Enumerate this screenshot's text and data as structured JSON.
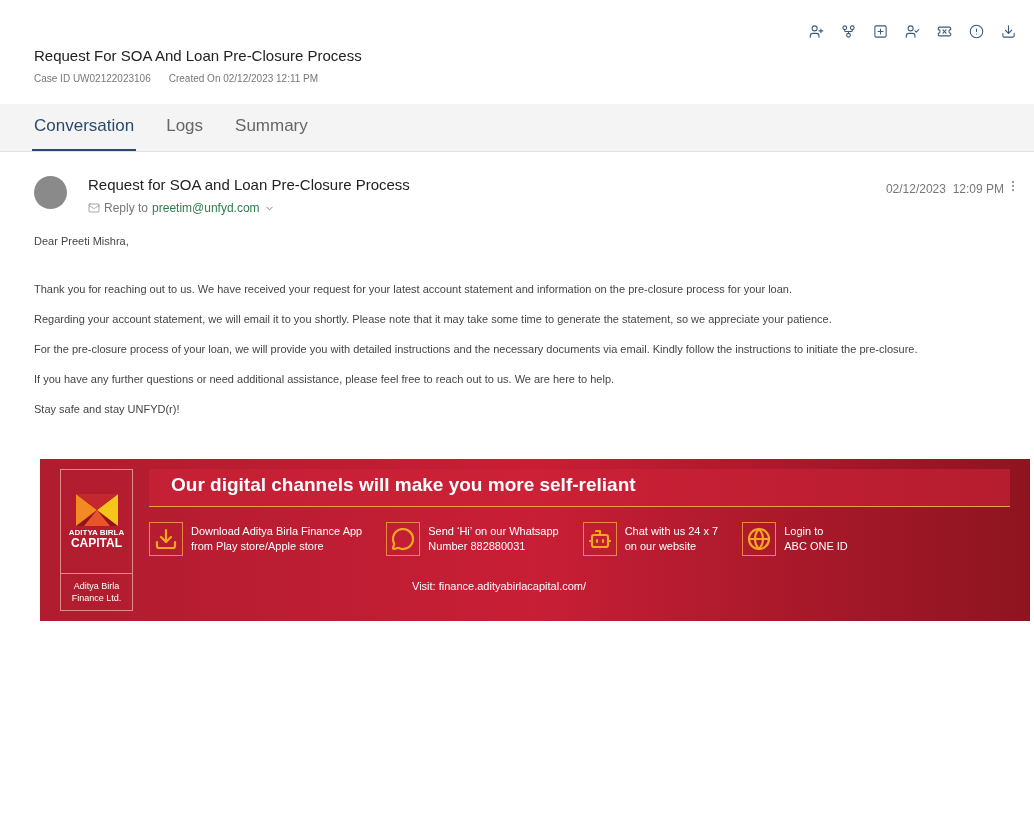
{
  "case": {
    "title": "Request For SOA And Loan Pre-Closure Process",
    "case_id": "Case ID UW02122023106",
    "created": "Created On 02/12/2023 12:11 PM"
  },
  "tabs": [
    {
      "label": "Conversation",
      "selected": true
    },
    {
      "label": "Logs",
      "selected": false
    },
    {
      "label": "Summary",
      "selected": false
    }
  ],
  "email": {
    "subject": "Request for SOA and Loan Pre-Closure Process",
    "reply_label": "Reply to",
    "reply_to": "preetim@unfyd.com",
    "timestamp": "02/12/2023  12:09 PM",
    "greeting": "Dear Preeti Mishra,",
    "paragraphs": [
      "Thank you for reaching out to us. We have received your request for your latest account statement and information on the pre-closure process for your loan.",
      "Regarding your account statement, we will email it to you shortly. Please note that it may take some time to generate the statement, so we appreciate your patience.",
      "For the pre-closure process of your loan, we will provide you with detailed instructions and the necessary documents via email. Kindly follow the instructions to initiate the pre-closure.",
      "If you have any further questions or need additional assistance, please feel free to reach out to us. We are here to help.",
      "Stay safe and stay UNFYD(r)!"
    ]
  },
  "banner": {
    "logo_top": "ADITYA BIRLA",
    "logo_main": "CAPITAL",
    "logo_sub": "Aditya Birla Finance Ltd.",
    "headline": "Our digital channels will make you more self-reliant",
    "items": [
      {
        "kind": "download",
        "lines": [
          "Download Aditya Birla Finance App",
          "from Play store/Apple store"
        ]
      },
      {
        "kind": "whatsapp",
        "lines": [
          "Send ‘Hi’ on our Whatsapp",
          "Number 882880031"
        ]
      },
      {
        "kind": "chat",
        "lines": [
          "Chat with us 24 x 7",
          "on our website"
        ]
      },
      {
        "kind": "login",
        "lines": [
          "Login to",
          "ABC ONE ID"
        ]
      }
    ],
    "visit": "Visit: finance.adityabirlacapital.com/"
  }
}
